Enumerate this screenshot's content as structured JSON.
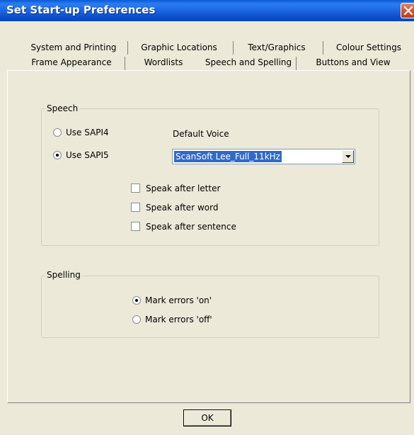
{
  "window": {
    "title": "Set Start-up Preferences"
  },
  "tabs": {
    "row1": [
      "System and Printing",
      "Graphic Locations",
      "Text/Graphics",
      "Colour Settings"
    ],
    "row2": [
      "Frame Appearance",
      "Wordlists",
      "Speech and Spelling",
      "Buttons and View"
    ],
    "active": "Speech and Spelling"
  },
  "speech": {
    "label": "Speech",
    "sapi4_label": "Use SAPI4",
    "sapi5_label": "Use SAPI5",
    "selected_engine": "SAPI5",
    "default_voice_label": "Default Voice",
    "voice_value": "ScanSoft Lee_Full_11kHz",
    "speak_after_letter": "Speak after letter",
    "speak_after_word": "Speak after word",
    "speak_after_sentence": "Speak after sentence"
  },
  "spelling": {
    "label": "Spelling",
    "errors_on": "Mark errors 'on'",
    "errors_off": "Mark errors 'off'",
    "selected": "on"
  },
  "footer": {
    "ok_label": "OK"
  }
}
